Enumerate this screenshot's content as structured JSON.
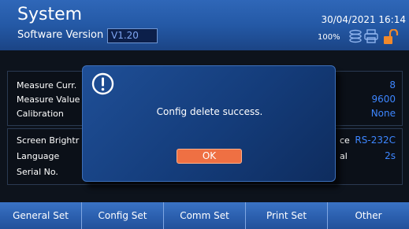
{
  "header": {
    "title": "System",
    "software_version_label": "Software Version",
    "software_version_value": "V1.20",
    "datetime": "30/04/2021 16:14",
    "battery": "100%"
  },
  "panel1": {
    "rows": [
      {
        "label": "Measure Curr.",
        "value": "8"
      },
      {
        "label": "Measure Value",
        "value": "9600"
      },
      {
        "label": "Calibration",
        "value": "None"
      }
    ]
  },
  "panel2": {
    "rows": [
      {
        "label": "Screen Brightr",
        "partial": "ce",
        "value": "RS-232C"
      },
      {
        "label": "Language",
        "partial": "al",
        "value": "2s"
      },
      {
        "label": "Serial No.",
        "partial": "",
        "value": ""
      }
    ]
  },
  "modal": {
    "message": "Config delete success.",
    "ok_label": "OK"
  },
  "tabs": [
    "General Set",
    "Config Set",
    "Comm Set",
    "Print Set",
    "Other"
  ],
  "icons": [
    "alert-icon",
    "disk-icon",
    "printer-icon",
    "unlock-icon"
  ],
  "colors": {
    "header": "#2459a6",
    "value_text": "#3d86ff",
    "ok_button": "#ef7043",
    "tab": "#2b5fae"
  }
}
